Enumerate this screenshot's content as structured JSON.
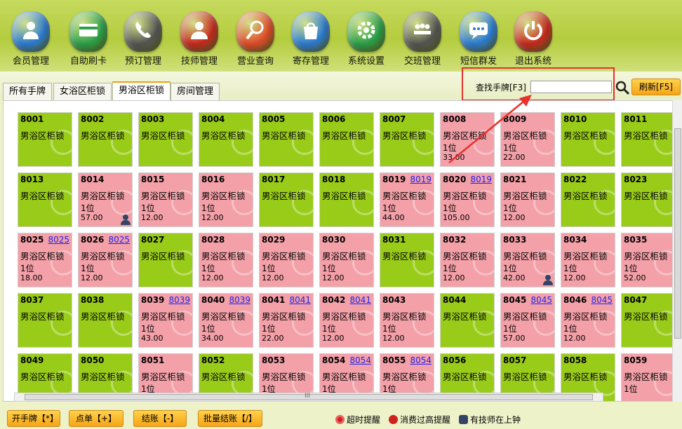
{
  "toolbar": {
    "items": [
      {
        "label": "会员管理",
        "icon": "member-icon",
        "color": "#2a7bd6"
      },
      {
        "label": "自助刷卡",
        "icon": "card-icon",
        "color": "#2aa04a"
      },
      {
        "label": "预订管理",
        "icon": "phone-icon",
        "color": "#555555"
      },
      {
        "label": "技师管理",
        "icon": "technician-icon",
        "color": "#c8281e"
      },
      {
        "label": "营业查询",
        "icon": "search-icon",
        "color": "#e04a2a"
      },
      {
        "label": "寄存管理",
        "icon": "bag-icon",
        "color": "#2a7bd6"
      },
      {
        "label": "系统设置",
        "icon": "gear-icon",
        "color": "#2aa04a"
      },
      {
        "label": "交班管理",
        "icon": "meeting-icon",
        "color": "#555555"
      },
      {
        "label": "短信群发",
        "icon": "sms-icon",
        "color": "#2a7bd6"
      },
      {
        "label": "退出系统",
        "icon": "power-icon",
        "color": "#c8281e"
      }
    ]
  },
  "tabs": [
    "所有手牌",
    "女浴区柜锁",
    "男浴区柜锁",
    "房间管理"
  ],
  "active_tab": 2,
  "search": {
    "label": "查找手牌[F3]",
    "value": "",
    "refresh_label": "刷新[F5]"
  },
  "colors": {
    "free": "#99cc18",
    "busy": "#f3a0a8",
    "accent": "#f7a418",
    "highlight": "#e8302c"
  },
  "cards": [
    {
      "num": "8001",
      "type": "男浴区柜锁",
      "status": "free"
    },
    {
      "num": "8002",
      "type": "男浴区柜锁",
      "status": "free"
    },
    {
      "num": "8003",
      "type": "男浴区柜锁",
      "status": "free"
    },
    {
      "num": "8004",
      "type": "男浴区柜锁",
      "status": "free"
    },
    {
      "num": "8005",
      "type": "男浴区柜锁",
      "status": "free"
    },
    {
      "num": "8006",
      "type": "男浴区柜锁",
      "status": "free"
    },
    {
      "num": "8007",
      "type": "男浴区柜锁",
      "status": "free"
    },
    {
      "num": "8008",
      "type": "男浴区柜锁",
      "status": "busy",
      "seat": "1位",
      "amount": "33.00"
    },
    {
      "num": "8009",
      "type": "男浴区柜锁",
      "status": "busy",
      "seat": "1位",
      "amount": "22.00"
    },
    {
      "num": "8010",
      "type": "男浴区柜锁",
      "status": "free"
    },
    {
      "num": "8011",
      "type": "男浴区柜锁",
      "status": "free"
    },
    {
      "num": "8013",
      "type": "男浴区柜锁",
      "status": "free"
    },
    {
      "num": "8014",
      "type": "男浴区柜锁",
      "status": "busy",
      "seat": "1位",
      "amount": "57.00",
      "tech": true
    },
    {
      "num": "8015",
      "type": "男浴区柜锁",
      "status": "busy",
      "seat": "1位",
      "amount": "12.00"
    },
    {
      "num": "8016",
      "type": "男浴区柜锁",
      "status": "busy",
      "seat": "1位",
      "amount": "12.00"
    },
    {
      "num": "8017",
      "type": "男浴区柜锁",
      "status": "free"
    },
    {
      "num": "8018",
      "type": "男浴区柜锁",
      "status": "free"
    },
    {
      "num": "8019",
      "link": "8019",
      "type": "男浴区柜锁",
      "status": "busy",
      "seat": "1位",
      "amount": "44.00"
    },
    {
      "num": "8020",
      "link": "8019",
      "type": "男浴区柜锁",
      "status": "busy",
      "seat": "1位",
      "amount": "105.00"
    },
    {
      "num": "8021",
      "type": "男浴区柜锁",
      "status": "busy",
      "seat": "1位",
      "amount": "12.00"
    },
    {
      "num": "8022",
      "type": "男浴区柜锁",
      "status": "free"
    },
    {
      "num": "8023",
      "type": "男浴区柜锁",
      "status": "free"
    },
    {
      "num": "8025",
      "link": "8025",
      "type": "男浴区柜锁",
      "status": "busy",
      "seat": "1位",
      "amount": "18.00"
    },
    {
      "num": "8026",
      "link": "8025",
      "type": "男浴区柜锁",
      "status": "busy",
      "seat": "1位",
      "amount": "12.00"
    },
    {
      "num": "8027",
      "type": "男浴区柜锁",
      "status": "free"
    },
    {
      "num": "8028",
      "type": "男浴区柜锁",
      "status": "busy",
      "seat": "1位",
      "amount": "12.00"
    },
    {
      "num": "8029",
      "type": "男浴区柜锁",
      "status": "busy",
      "seat": "1位",
      "amount": "12.00"
    },
    {
      "num": "8030",
      "type": "男浴区柜锁",
      "status": "busy",
      "seat": "1位",
      "amount": "12.00"
    },
    {
      "num": "8031",
      "type": "男浴区柜锁",
      "status": "free"
    },
    {
      "num": "8032",
      "type": "男浴区柜锁",
      "status": "busy",
      "seat": "1位",
      "amount": "12.00"
    },
    {
      "num": "8033",
      "type": "男浴区柜锁",
      "status": "busy",
      "seat": "1位",
      "amount": "42.00",
      "tech": true
    },
    {
      "num": "8034",
      "type": "男浴区柜锁",
      "status": "busy",
      "seat": "1位",
      "amount": "12.00"
    },
    {
      "num": "8035",
      "type": "男浴区柜锁",
      "status": "busy",
      "seat": "1位",
      "amount": "52.00"
    },
    {
      "num": "8037",
      "type": "男浴区柜锁",
      "status": "free"
    },
    {
      "num": "8038",
      "type": "男浴区柜锁",
      "status": "free"
    },
    {
      "num": "8039",
      "link": "8039",
      "type": "男浴区柜锁",
      "status": "busy",
      "seat": "1位",
      "amount": "43.00"
    },
    {
      "num": "8040",
      "link": "8039",
      "type": "男浴区柜锁",
      "status": "busy",
      "seat": "1位",
      "amount": "34.00"
    },
    {
      "num": "8041",
      "link": "8041",
      "type": "男浴区柜锁",
      "status": "busy",
      "seat": "1位",
      "amount": "22.00"
    },
    {
      "num": "8042",
      "link": "8041",
      "type": "男浴区柜锁",
      "status": "busy",
      "seat": "1位",
      "amount": "12.00"
    },
    {
      "num": "8043",
      "type": "男浴区柜锁",
      "status": "busy",
      "seat": "1位",
      "amount": "12.00"
    },
    {
      "num": "8044",
      "type": "男浴区柜锁",
      "status": "free"
    },
    {
      "num": "8045",
      "link": "8045",
      "type": "男浴区柜锁",
      "status": "busy",
      "seat": "1位",
      "amount": "57.00"
    },
    {
      "num": "8046",
      "link": "8045",
      "type": "男浴区柜锁",
      "status": "busy",
      "seat": "1位",
      "amount": "12.00"
    },
    {
      "num": "8047",
      "type": "男浴区柜锁",
      "status": "free"
    },
    {
      "num": "8049",
      "type": "男浴区柜锁",
      "status": "free"
    },
    {
      "num": "8050",
      "type": "男浴区柜锁",
      "status": "free"
    },
    {
      "num": "8051",
      "type": "男浴区柜锁",
      "status": "busy",
      "seat": "1位"
    },
    {
      "num": "8052",
      "type": "男浴区柜锁",
      "status": "free"
    },
    {
      "num": "8053",
      "type": "男浴区柜锁",
      "status": "busy",
      "seat": "1位"
    },
    {
      "num": "8054",
      "link": "8054",
      "type": "男浴区柜锁",
      "status": "busy",
      "seat": "1位"
    },
    {
      "num": "8055",
      "link": "8054",
      "type": "男浴区柜锁",
      "status": "busy",
      "seat": "1位"
    },
    {
      "num": "8056",
      "type": "男浴区柜锁",
      "status": "free"
    },
    {
      "num": "8057",
      "type": "男浴区柜锁",
      "status": "free"
    },
    {
      "num": "8058",
      "type": "男浴区柜锁",
      "status": "free"
    },
    {
      "num": "8059",
      "type": "男浴区柜锁",
      "status": "busy",
      "seat": "1位"
    }
  ],
  "bottom_buttons": [
    "开手牌【*】",
    "点单【+】",
    "结账【-】",
    "批量结账【/】"
  ],
  "legend": [
    {
      "label": "超时提醒",
      "icon": "no-entry-icon",
      "color": "#d02020"
    },
    {
      "label": "消费过高提醒",
      "icon": "alert-icon",
      "color": "#d02020"
    },
    {
      "label": "有技师在上钟",
      "icon": "technician-icon",
      "color": "#334466"
    }
  ],
  "scroll_grip": "III"
}
